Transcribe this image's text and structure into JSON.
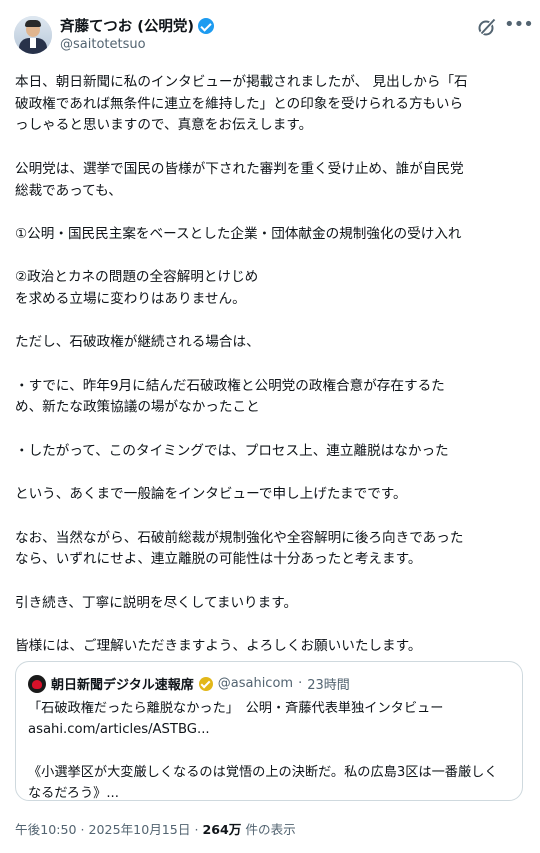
{
  "author": {
    "display_name": "斉藤てつお (公明党)",
    "handle": "@saitotetsuo",
    "verified_color": "#1d9bf0"
  },
  "icons": {
    "grok": "grok-icon",
    "more": "more-icon"
  },
  "tweet": {
    "paragraphs": [
      "本日、朝日新聞に私のインタビューが掲載されましたが、 見出しから「石\n破政権であれば無条件に連立を維持した」との印象を受けられる方もいら\nっしゃると思いますので、真意をお伝えします。",
      "公明党は、選挙で国民の皆様が下された審判を重く受け止め、誰が自民党\n総裁であっても、",
      "①公明・国民民主案をベースとした企業・団体献金の規制強化の受け入れ",
      "②政治とカネの問題の全容解明とけじめ\nを求める立場に変わりはありません。",
      "ただし、石破政権が継続される場合は、",
      "・すでに、昨年9月に結んだ石破政権と公明党の政権合意が存在するた\nめ、新たな政策協議の場がなかったこと",
      "・したがって、このタイミングでは、プロセス上、連立離脱はなかった",
      "という、あくまで一般論をインタビューで申し上げたまでです。",
      "なお、当然ながら、石破前総裁が規制強化や全容解明に後ろ向きであった\nなら、いずれにせよ、連立離脱の可能性は十分あったと考えます。",
      "引き続き、丁寧に説明を尽くしてまいります。",
      "皆様には、ご理解いただきますよう、よろしくお願いいたします。"
    ]
  },
  "quote": {
    "name": "朝日新聞デジタル速報席",
    "handle": "@asahicom",
    "separator": "·",
    "time": "23時間",
    "verified_color": "#e2b719",
    "line1": "「石破政権だったら離脱なかった」　公明・斉藤代表単独インタビュー",
    "line2": "asahi.com/articles/ASTBG...",
    "line3": "《小選挙区が大変厳しくなるのは覚悟の上の決断だ。私の広島3区は一番厳しく\nなるだろう》..."
  },
  "footer": {
    "time": "午後10:50",
    "separator": "·",
    "date": "2025年10月15日",
    "views": "264万",
    "views_label": "件の表示"
  }
}
